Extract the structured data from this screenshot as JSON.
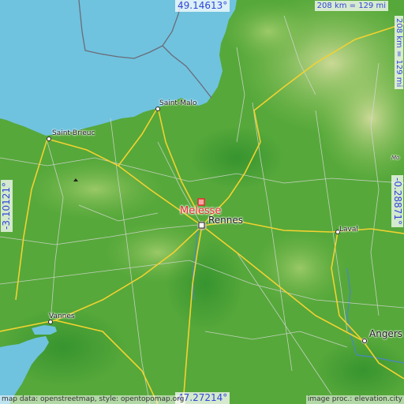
{
  "map": {
    "place": "Melesse",
    "colors": {
      "sea": "#6fc3de",
      "low_land": "#48a235",
      "mid_land": "#7cbc52",
      "high_land": "#c9d890",
      "roads": "#f3d230",
      "highlight": "#e62b2b",
      "coord_text": "#2f47d8"
    }
  },
  "coordinates": {
    "north": "49.14613°",
    "south": "47.27214°",
    "west": "-3.10121°",
    "east": "-0.28871°"
  },
  "scale": {
    "horizontal": "208 km = 129 mi",
    "vertical": "208 km = 129 mi"
  },
  "cities": {
    "saint_malo": "Saint-Malo",
    "saint_brieuc": "Saint-Brieuc",
    "rennes": "Rennes",
    "laval": "Laval",
    "vannes": "Vannes",
    "angers": "Angers",
    "partial_right": "Mo"
  },
  "attribution": {
    "left": "map data: openstreetmap, style: opentopomap.org",
    "right": "image proc.: elevation.city"
  }
}
